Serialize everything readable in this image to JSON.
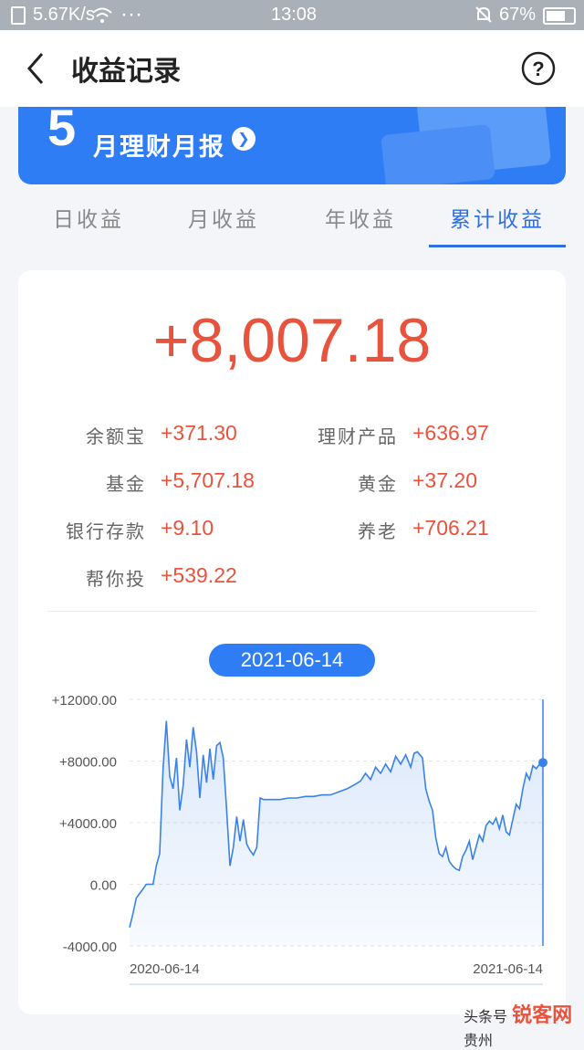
{
  "status_bar": {
    "speed": "5.67K/s",
    "dots": "···",
    "time": "13:08",
    "battery": "67%"
  },
  "header": {
    "title": "收益记录"
  },
  "banner": {
    "month": "5",
    "text": "月理财月报"
  },
  "tabs": [
    {
      "label": "日收益",
      "active": false
    },
    {
      "label": "月收益",
      "active": false
    },
    {
      "label": "年收益",
      "active": false
    },
    {
      "label": "累计收益",
      "active": true
    }
  ],
  "summary": {
    "total": "+8,007.18",
    "items": [
      {
        "label": "余额宝",
        "value": "+371.30"
      },
      {
        "label": "理财产品",
        "value": "+636.97"
      },
      {
        "label": "基金",
        "value": "+5,707.18"
      },
      {
        "label": "黄金",
        "value": "+37.20"
      },
      {
        "label": "银行存款",
        "value": "+9.10"
      },
      {
        "label": "养老",
        "value": "+706.21"
      },
      {
        "label": "帮你投",
        "value": "+539.22"
      }
    ]
  },
  "selected_date": "2021-06-14",
  "watermark": {
    "prefix": "头条号 ",
    "brand": "锐客网",
    "suffix": "贵州"
  },
  "chart_data": {
    "type": "area",
    "color": "#3a82e8",
    "x_start": "2020-06-14",
    "x_end": "2021-06-14",
    "xlabels": [
      "2020-06-14",
      "2021-06-14"
    ],
    "ylabels": [
      "+12000.00",
      "+8000.00",
      "+4000.00",
      "0.00",
      "-4000.00"
    ],
    "ylim": [
      -4000,
      12000
    ],
    "points": [
      [
        0,
        -2800
      ],
      [
        2,
        -1900
      ],
      [
        4,
        -900
      ],
      [
        6,
        -600
      ],
      [
        8,
        -300
      ],
      [
        10,
        0
      ],
      [
        12,
        0
      ],
      [
        14,
        0
      ],
      [
        16,
        1200
      ],
      [
        18,
        2000
      ],
      [
        20,
        7500
      ],
      [
        22,
        10600
      ],
      [
        24,
        7000
      ],
      [
        26,
        6200
      ],
      [
        28,
        8200
      ],
      [
        30,
        4800
      ],
      [
        32,
        6400
      ],
      [
        34,
        9400
      ],
      [
        36,
        7600
      ],
      [
        38,
        10200
      ],
      [
        40,
        8600
      ],
      [
        42,
        5600
      ],
      [
        44,
        8400
      ],
      [
        46,
        6600
      ],
      [
        48,
        8800
      ],
      [
        50,
        6800
      ],
      [
        52,
        9000
      ],
      [
        54,
        9200
      ],
      [
        56,
        8200
      ],
      [
        58,
        4800
      ],
      [
        60,
        1200
      ],
      [
        62,
        2400
      ],
      [
        64,
        4400
      ],
      [
        66,
        2800
      ],
      [
        68,
        4200
      ],
      [
        70,
        2600
      ],
      [
        72,
        2200
      ],
      [
        74,
        1900
      ],
      [
        76,
        2400
      ],
      [
        78,
        5600
      ],
      [
        80,
        5500
      ],
      [
        85,
        5500
      ],
      [
        90,
        5500
      ],
      [
        95,
        5600
      ],
      [
        100,
        5600
      ],
      [
        105,
        5700
      ],
      [
        110,
        5700
      ],
      [
        115,
        5800
      ],
      [
        120,
        5800
      ],
      [
        125,
        6000
      ],
      [
        130,
        6200
      ],
      [
        135,
        6500
      ],
      [
        138,
        6700
      ],
      [
        141,
        7200
      ],
      [
        144,
        6800
      ],
      [
        147,
        7600
      ],
      [
        150,
        7200
      ],
      [
        153,
        7800
      ],
      [
        156,
        7300
      ],
      [
        159,
        8300
      ],
      [
        162,
        7800
      ],
      [
        165,
        8400
      ],
      [
        168,
        7600
      ],
      [
        170,
        8500
      ],
      [
        172,
        8600
      ],
      [
        175,
        8200
      ],
      [
        177,
        6200
      ],
      [
        179,
        5400
      ],
      [
        181,
        4800
      ],
      [
        183,
        3000
      ],
      [
        185,
        2000
      ],
      [
        187,
        1800
      ],
      [
        189,
        2400
      ],
      [
        191,
        1500
      ],
      [
        193,
        1200
      ],
      [
        195,
        1000
      ],
      [
        197,
        900
      ],
      [
        199,
        1800
      ],
      [
        201,
        2200
      ],
      [
        203,
        2800
      ],
      [
        205,
        1600
      ],
      [
        207,
        2400
      ],
      [
        209,
        3200
      ],
      [
        211,
        2800
      ],
      [
        213,
        3800
      ],
      [
        215,
        4100
      ],
      [
        217,
        3900
      ],
      [
        219,
        4300
      ],
      [
        221,
        3600
      ],
      [
        223,
        4500
      ],
      [
        225,
        3400
      ],
      [
        227,
        3200
      ],
      [
        229,
        4200
      ],
      [
        231,
        5200
      ],
      [
        233,
        4900
      ],
      [
        235,
        6200
      ],
      [
        237,
        7200
      ],
      [
        239,
        6800
      ],
      [
        241,
        7700
      ],
      [
        243,
        7500
      ],
      [
        245,
        7800
      ],
      [
        247,
        7900
      ]
    ],
    "last_point": [
      247,
      7900
    ]
  }
}
